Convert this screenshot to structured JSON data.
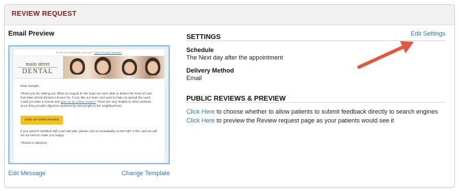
{
  "panel": {
    "title": "REVIEW REQUEST"
  },
  "email_preview": {
    "heading": "Email Preview",
    "top_line": "Email not displaying correctly?",
    "top_line_link": "View it in your browser.",
    "logo_line1": "main street",
    "logo_line2": "DENTAL",
    "greeting": "Dear Sample,",
    "paragraph1_start": "Thank you for visiting our office on August 9! We hope we were able to deliver the level of care that Main Street Dental is known for. If you like our team and want to help us spread the word, could you take a minute and",
    "paragraph1_link": "give us an online review?",
    "paragraph1_end": "There are very helpful to other patients, since they provide objective opinions by real people in the neighborhood.",
    "button_label": "Write an Online Review",
    "paragraph2": "If you weren't satisfied with your last visit, please call us immediately at 847-597-1750, and we will do our best to make you happy.",
    "closing": "Thanks in advance,",
    "edit_message": "Edit Message",
    "change_template": "Change Template"
  },
  "settings": {
    "heading": "SETTINGS",
    "edit_link": "Edit Settings",
    "schedule_label": "Schedule",
    "schedule_value": "The Next day after the appointment",
    "delivery_label": "Delivery Method",
    "delivery_value": "Email"
  },
  "public_reviews": {
    "heading": "PUBLIC REVIEWS & PREVIEW",
    "line1_link": "Click Here",
    "line1_text": " to choose whether to allow patients to submit feedback directly to search engines",
    "line2_link": "Click Here",
    "line2_text": " to preview the Review request page as your patients would see it"
  },
  "colors": {
    "title": "#8b1a1a",
    "link": "#2a7abf",
    "preview_border": "#8ec1ea",
    "button": "#f5c21b",
    "arrow": "#e5553f"
  },
  "icons": {
    "annotation": "red-arrow-icon"
  }
}
